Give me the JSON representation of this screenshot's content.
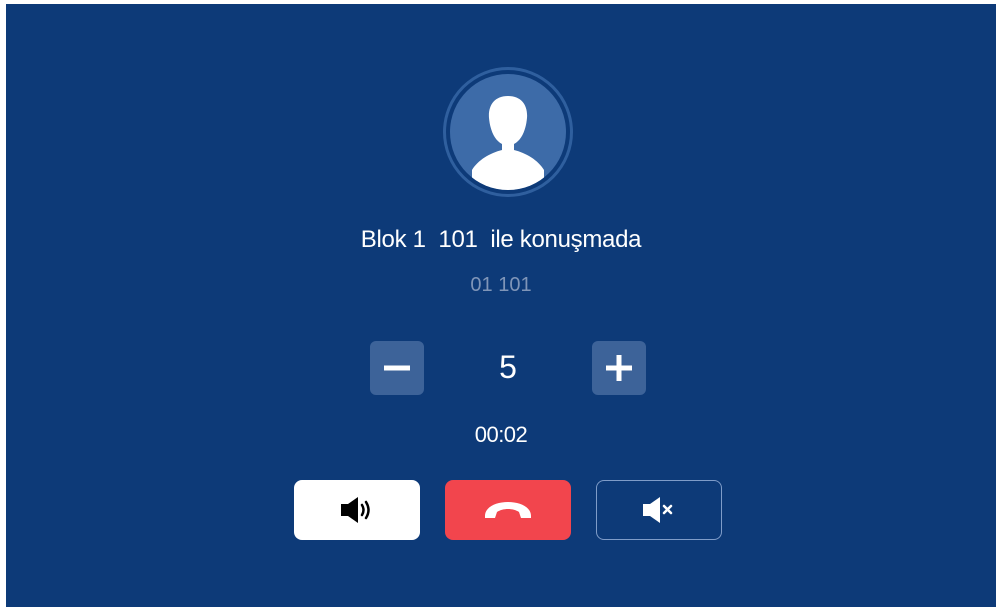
{
  "call": {
    "caller_name": "Blok 1  101",
    "status_text": "  ile konuşmada",
    "caller_number": "01 101",
    "timer": "00:02"
  },
  "volume": {
    "value": "5",
    "decrease_icon": "minus-icon",
    "increase_icon": "plus-icon"
  },
  "actions": {
    "speaker_icon": "speaker-icon",
    "hangup_icon": "phone-hangup-icon",
    "mute_icon": "mute-icon"
  },
  "colors": {
    "background": "#0d3a78",
    "button_secondary": "#3d6399",
    "hangup": "#f2454d",
    "speaker_bg": "#ffffff",
    "muted_text": "#7f95b8"
  }
}
